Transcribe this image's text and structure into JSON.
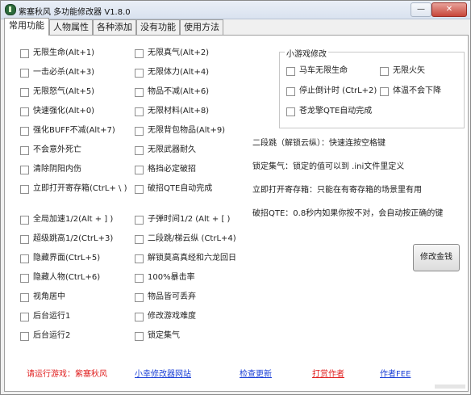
{
  "window": {
    "title": "紫塞秋风 多功能修改器 V1.8.0",
    "min_label": "—",
    "close_label": "✕"
  },
  "tabs": [
    "常用功能",
    "人物属性",
    "各种添加",
    "没有功能",
    "使用方法"
  ],
  "left_col": [
    "无限生命(Alt+1)",
    "一击必杀(Alt+3)",
    "无限怒气(Alt+5)",
    "快速强化(Alt+0)",
    "强化BUFF不减(Alt+7)",
    "不会意外死亡",
    "清除阴阳内伤",
    "立即打开寄存箱(CtrL+ \\ )",
    "全局加速1/2(Alt + ] )",
    "超级跳高1/2(CtrL+3)",
    "隐藏界面(CtrL+5)",
    "隐藏人物(CtrL+6)",
    "视角居中",
    "后台运行1",
    "后台运行2"
  ],
  "mid_col": [
    "无限真气(Alt+2)",
    "无限体力(Alt+4)",
    "物品不减(Alt+6)",
    "无限材料(Alt+8)",
    "无限背包物品(Alt+9)",
    "无限武器耐久",
    "格挡必定破招",
    "破招QTE自动完成",
    "子弹时间1/2 (Alt + [ )",
    "二段跳/梯云纵 (CtrL+4)",
    "解锁莫高真经和六龙回日",
    "100%暴击率",
    "物品皆可丢弃",
    "修改游戏难度",
    "锁定集气"
  ],
  "minigame": {
    "legend": "小游戏修改",
    "items": [
      "马车无限生命",
      "无限火矢",
      "停止倒计时 (CtrL+2)",
      "体温不会下降",
      "苍龙擎QTE自动完成"
    ]
  },
  "info": [
    "二段跳（解锁云纵）：快速连按空格键",
    "锁定集气：锁定的值可以到 .ini文件里定义",
    "立即打开寄存箱：只能在有寄存箱的场景里有用",
    "破招QTE：0.8秒内如果你按不对，会自动按正确的键"
  ],
  "buttons": {
    "modify_money": "修改金钱"
  },
  "footer": {
    "game_label": "请运行游戏：紫塞秋风",
    "site_link": "小幸修改器网站",
    "update_link": "检查更新",
    "donate_link": "打赏作者",
    "author_link": "作者FEE"
  },
  "colors": {
    "link_red": "#e02020",
    "link_blue": "#1a3fd6"
  }
}
